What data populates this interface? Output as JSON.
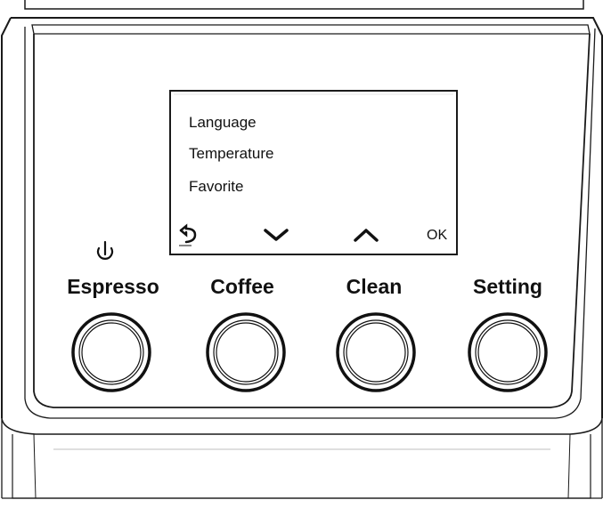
{
  "display": {
    "menu_items": [
      "Language",
      "Temperature",
      "Favorite"
    ],
    "softkeys": {
      "back_icon": "back-arrow-icon",
      "down_icon": "chevron-down-icon",
      "up_icon": "chevron-up-icon",
      "ok_label": "OK"
    }
  },
  "buttons": [
    {
      "label": "Espresso",
      "icon": "power-icon"
    },
    {
      "label": "Coffee"
    },
    {
      "label": "Clean"
    },
    {
      "label": "Setting"
    }
  ],
  "colors": {
    "line": "#1a1a1a",
    "background": "#ffffff"
  }
}
